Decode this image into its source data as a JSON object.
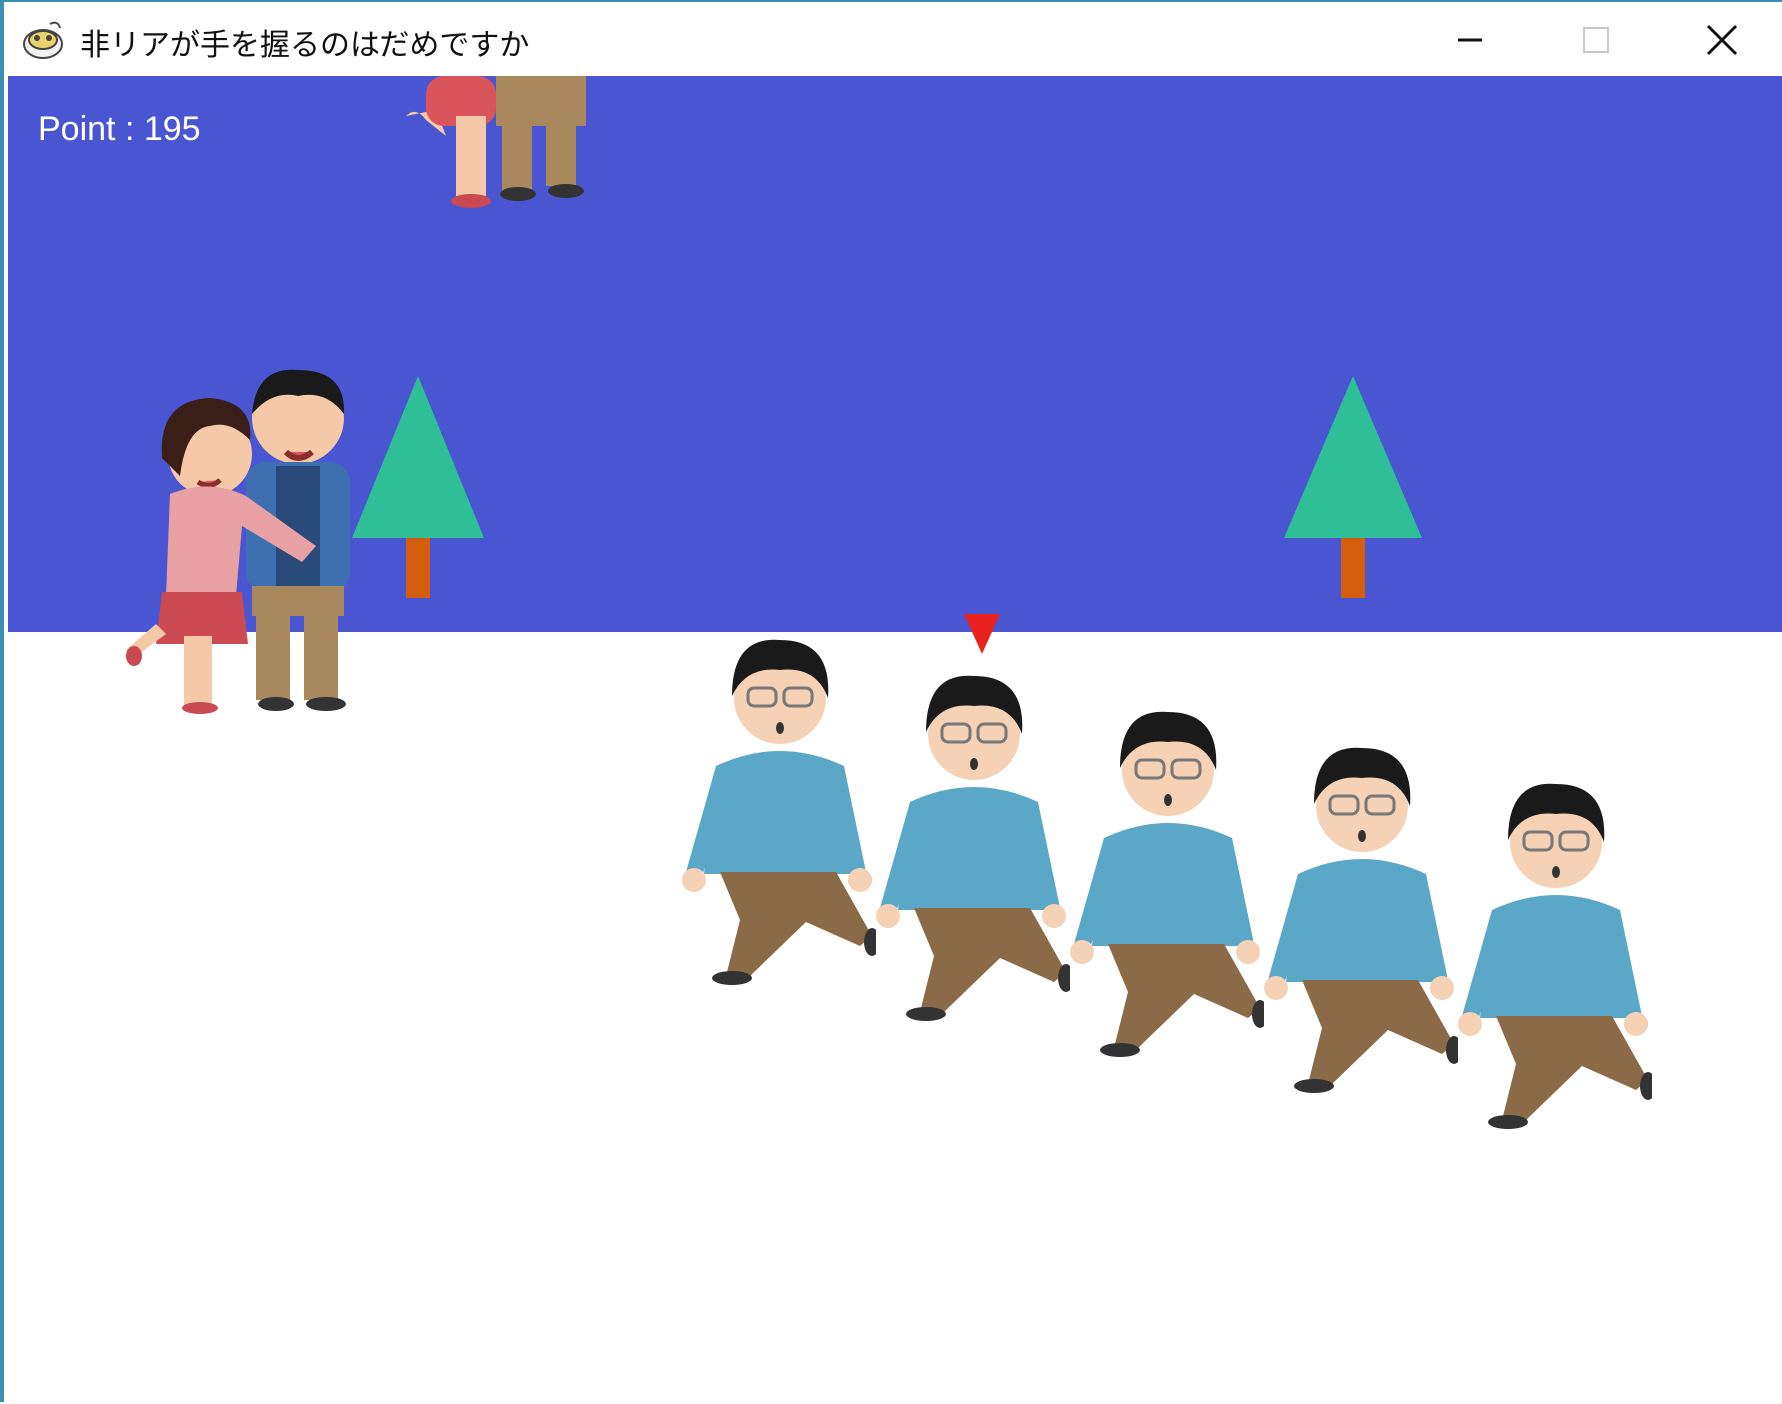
{
  "window": {
    "title": "非リアが手を握るのはだめですか",
    "icon": "app-icon",
    "buttons": [
      "minimize-icon",
      "maximize-icon",
      "close-icon"
    ]
  },
  "game": {
    "score_text": "Point : 195",
    "colors": {
      "sky": "#4a55d2",
      "ground": "#ffffff",
      "tree_leaves": "#2fbf96",
      "tree_trunk": "#d35f0e",
      "marker": "#e8231e",
      "shirt": "#5aa7c8",
      "pants": "#8b6b47",
      "hair": "#1a1a1a"
    },
    "sprites": {
      "trees": [
        "tree",
        "tree"
      ],
      "couples": [
        "couple",
        "couple"
      ],
      "player_marker": "red-triangle-marker",
      "boys": [
        "boy",
        "boy",
        "boy",
        "boy",
        "boy"
      ]
    }
  }
}
